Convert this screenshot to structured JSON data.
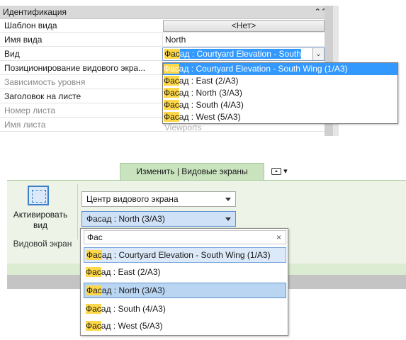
{
  "props": {
    "section_title": "Идентификация",
    "collapse_icon": "double-chevron-up",
    "rows": [
      {
        "label": "Шаблон вида",
        "value": "<Нет>"
      },
      {
        "label": "Имя вида",
        "value": "North"
      },
      {
        "label": "Вид",
        "value_match": "Фас",
        "value_rest_before_hl": "ад",
        "value_hl": " : Courtyard Elevation - South"
      },
      {
        "label": "Позиционирование видового экра...",
        "value": ""
      },
      {
        "label": "Зависимость уровня",
        "value": ""
      },
      {
        "label": "Заголовок на листе",
        "value": ""
      },
      {
        "label": "Номер листа",
        "value": ""
      },
      {
        "label": "Имя листа",
        "value": "Viewports"
      }
    ],
    "dropdown": [
      {
        "match": "Фас",
        "rest": "ад : Courtyard Elevation - South Wing (1/A3)"
      },
      {
        "match": "Фас",
        "rest": "ад : East (2/A3)"
      },
      {
        "match": "Фас",
        "rest": "ад : North (3/A3)"
      },
      {
        "match": "Фас",
        "rest": "ад : South (4/A3)"
      },
      {
        "match": "Фас",
        "rest": "ад : West (5/A3)"
      }
    ]
  },
  "ribbon": {
    "tab_label": "Изменить | Видовые экраны",
    "activate_label_line1": "Активировать",
    "activate_label_line2": "вид",
    "panel_title": "Видовой экран",
    "combo_position": "Центр видового экрана",
    "combo_view": "Фасад : North (3/A3)",
    "search_value": "Фас",
    "search_clear": "×",
    "options": [
      {
        "match": "Фас",
        "rest": "ад : Courtyard Elevation - South Wing (1/A3)"
      },
      {
        "match": "Фас",
        "rest": "ад : East (2/A3)"
      },
      {
        "match": "Фас",
        "rest": "ад : North (3/A3)"
      },
      {
        "match": "Фас",
        "rest": "ад : South (4/A3)"
      },
      {
        "match": "Фас",
        "rest": "ад : West (5/A3)"
      }
    ]
  },
  "colors": {
    "highlight_blue": "#3399ff",
    "match_yellow": "#ffd84a",
    "ribbon_green": "#c9e3bf"
  }
}
